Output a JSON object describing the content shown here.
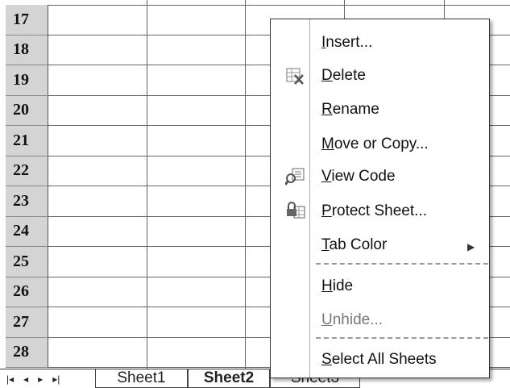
{
  "rows": [
    "17",
    "18",
    "19",
    "20",
    "21",
    "22",
    "23",
    "24",
    "25",
    "26",
    "27",
    "28"
  ],
  "context_menu": {
    "items": [
      {
        "key": "I",
        "rest": "nsert...",
        "icon": "",
        "disabled": false
      },
      {
        "key": "D",
        "rest": "elete",
        "icon": "delete-sheet-icon",
        "disabled": false
      },
      {
        "key": "R",
        "rest": "ename",
        "icon": "",
        "disabled": false
      },
      {
        "key": "M",
        "rest": "ove or Copy...",
        "icon": "",
        "disabled": false
      },
      {
        "key": "V",
        "rest": "iew Code",
        "icon": "view-code-icon",
        "disabled": false
      },
      {
        "key": "P",
        "rest": "rotect Sheet...",
        "icon": "protect-sheet-icon",
        "disabled": false
      },
      {
        "key": "T",
        "rest": "ab Color",
        "icon": "",
        "disabled": false,
        "submenu": true
      },
      {
        "key": "H",
        "rest": "ide",
        "icon": "",
        "disabled": false
      },
      {
        "key": "U",
        "rest": "nhide...",
        "icon": "",
        "disabled": true
      },
      {
        "key": "S",
        "rest": "elect All Sheets",
        "icon": "",
        "disabled": false
      }
    ]
  },
  "tabs": {
    "nav": [
      "|◂",
      "◂",
      "▸",
      "▸|"
    ],
    "sheets": [
      "Sheet1",
      "Sheet2",
      "Sheet3"
    ],
    "active": "Sheet2"
  }
}
